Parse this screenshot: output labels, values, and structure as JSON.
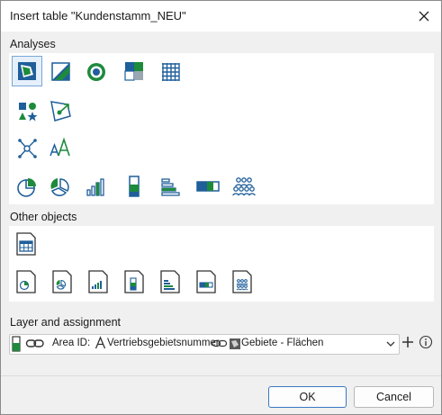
{
  "window": {
    "title": "Insert table \"Kundenstamm_NEU\""
  },
  "sections": {
    "analyses": "Analyses",
    "other_objects": "Other objects",
    "layer_assignment": "Layer and assignment"
  },
  "assignment": {
    "area_id_label": "Area ID:",
    "field_name": "Vertriebsgebietsnummer",
    "layer_name": "Gebiete - Flächen"
  },
  "buttons": {
    "ok": "OK",
    "cancel": "Cancel"
  },
  "colors": {
    "accent_blue": "#1f5f9a",
    "accent_green": "#1e8a3c",
    "selection": "#e5f0fb"
  }
}
